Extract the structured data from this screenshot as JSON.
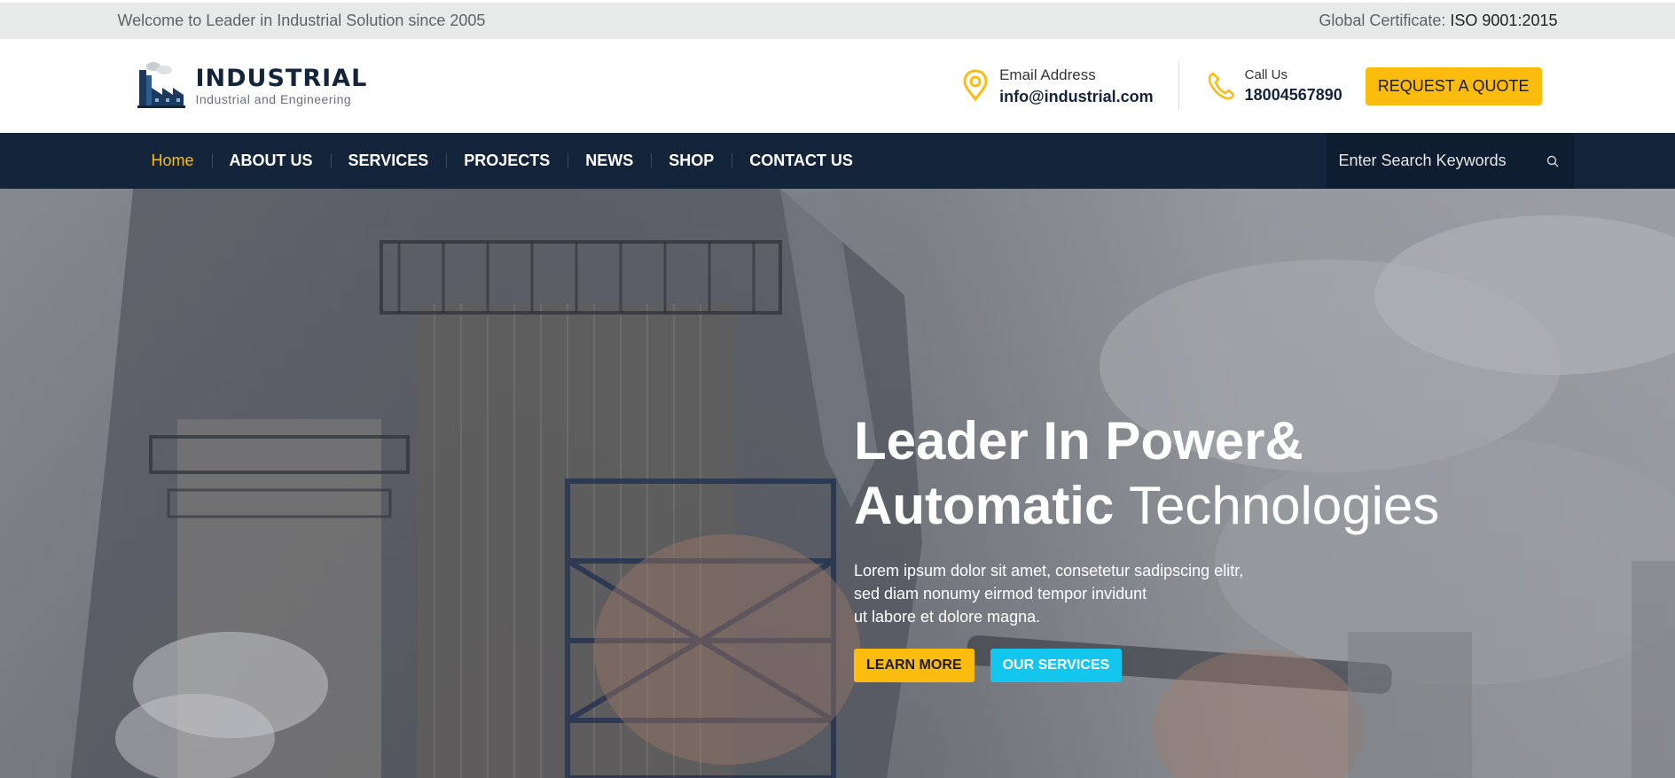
{
  "topbar": {
    "welcome": "Welcome to Leader in Industrial Solution since 2005",
    "cert_label": "Global Certificate:",
    "cert_value": "ISO 9001:2015"
  },
  "header": {
    "logo_title": "INDUSTRIAL",
    "logo_subtitle": "Industrial and Engineering",
    "email_label": "Email Address",
    "email_value": "info@industrial.com",
    "call_label": "Call Us",
    "call_value": "18004567890",
    "quote_button": "REQUEST A QUOTE"
  },
  "nav": {
    "items": [
      {
        "label": "Home"
      },
      {
        "label": "ABOUT US"
      },
      {
        "label": "SERVICES"
      },
      {
        "label": "PROJECTS"
      },
      {
        "label": "NEWS"
      },
      {
        "label": "SHOP"
      },
      {
        "label": "CONTACT US"
      }
    ],
    "search_placeholder": "Enter Search Keywords"
  },
  "hero": {
    "title_line1": "Leader In Power&",
    "title_line2_bold": "Automatic",
    "title_line2_light": "Technologies",
    "text_line1": "Lorem ipsum dolor sit amet, consetetur sadipscing elitr,",
    "text_line2": "sed diam nonumy eirmod tempor invidunt",
    "text_line3": "ut labore et dolore magna.",
    "btn_learn": "LEARN MORE",
    "btn_services": "OUR SERVICES"
  },
  "colors": {
    "accent": "#fbbc0e",
    "navy": "#14243a",
    "cyan": "#13c6ee"
  },
  "icons": {
    "location": "location-pin-icon",
    "phone": "phone-icon",
    "search": "search-icon",
    "logo": "factory-icon"
  }
}
